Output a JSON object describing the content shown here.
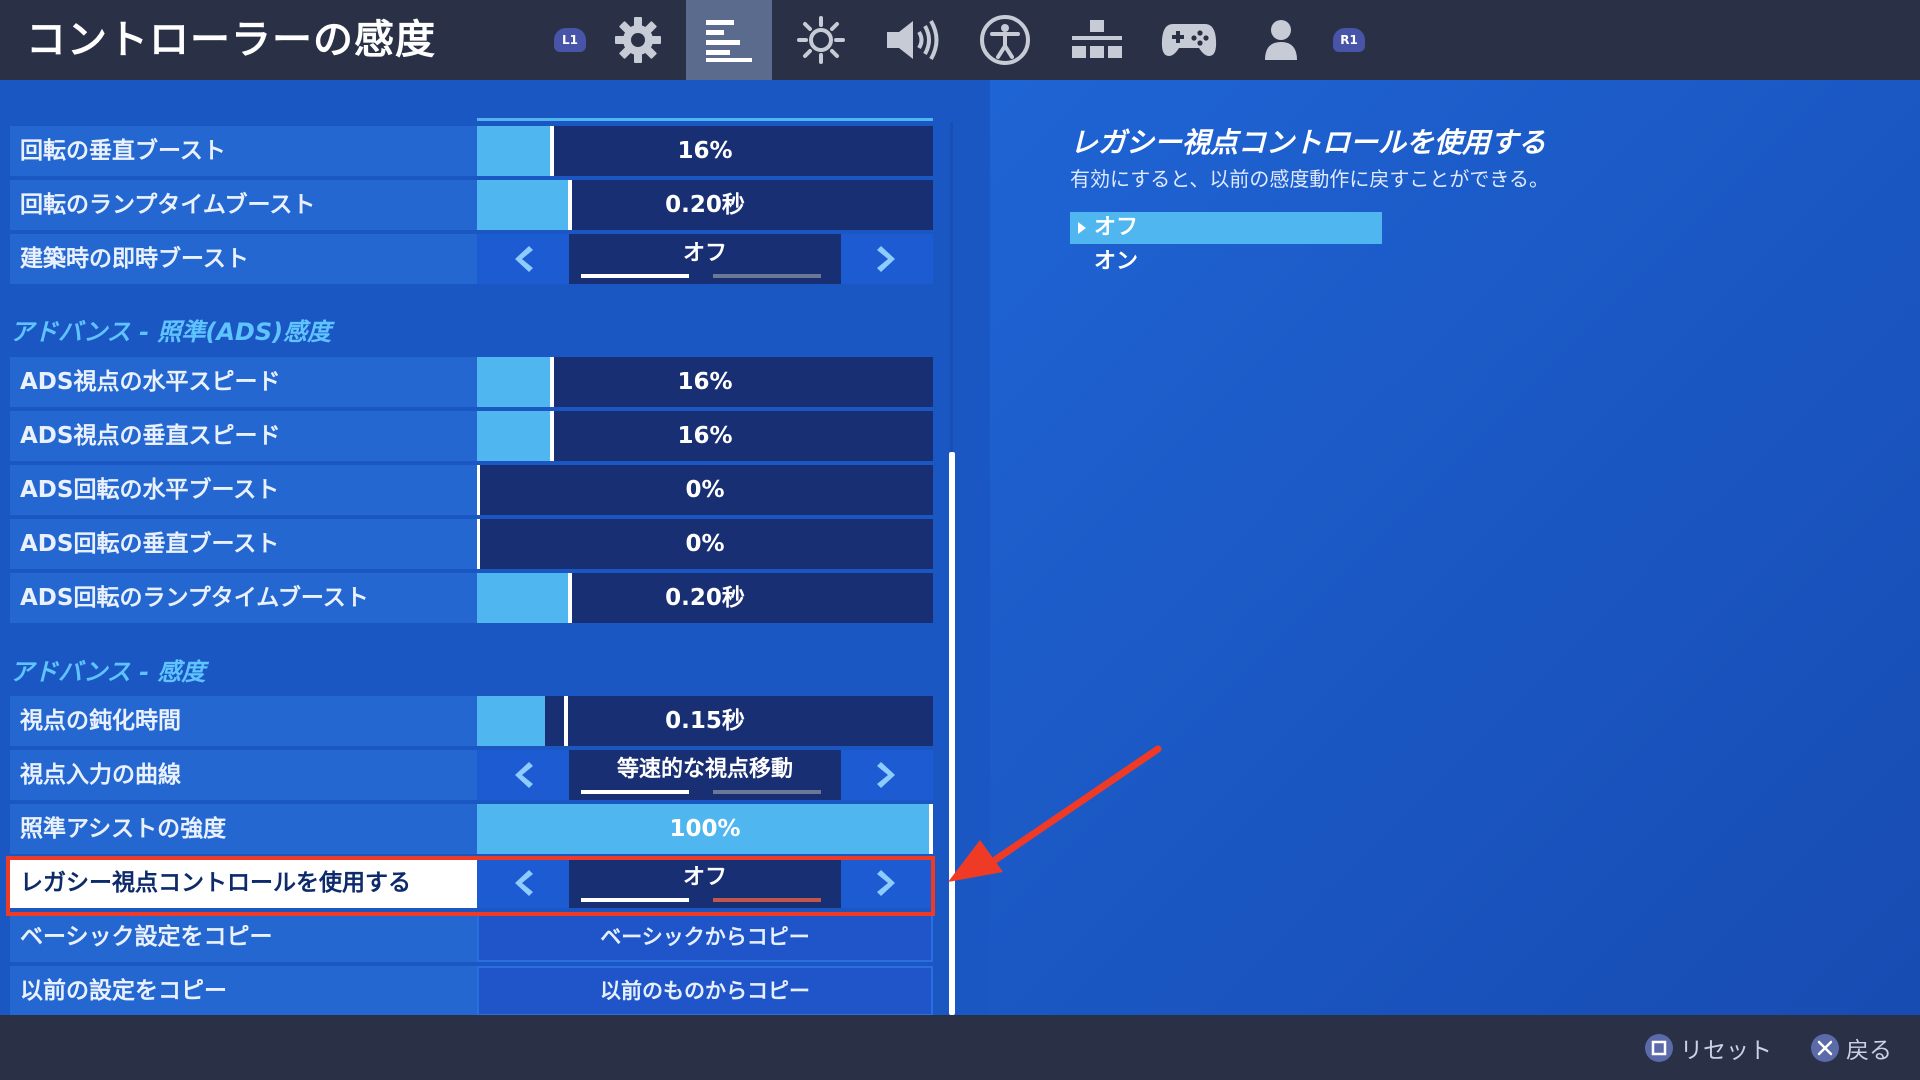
{
  "header": {
    "title": "コントローラーの感度",
    "tabs": [
      {
        "icon": "l1-bumper-icon",
        "label": "L1"
      },
      {
        "icon": "gear-icon"
      },
      {
        "icon": "list-settings-icon",
        "active": true
      },
      {
        "icon": "brightness-icon"
      },
      {
        "icon": "speaker-icon"
      },
      {
        "icon": "accessibility-icon"
      },
      {
        "icon": "build-blocks-icon"
      },
      {
        "icon": "gamepad-icon"
      },
      {
        "icon": "user-icon"
      },
      {
        "icon": "r1-bumper-icon",
        "label": "R1"
      }
    ]
  },
  "settings": {
    "rows_top": [
      {
        "label": "回転の垂直ブースト",
        "type": "slider",
        "value": "16%",
        "fill_fraction": 0.16
      },
      {
        "label": "回転のランプタイムブースト",
        "type": "slider",
        "value": "0.20秒",
        "fill_fraction": 0.2
      },
      {
        "label": "建築時の即時ブースト",
        "type": "selector",
        "value": "オフ",
        "option_index": 0,
        "option_count": 2
      }
    ],
    "section_ads": {
      "title": "アドバンス - 照準(ADS)感度",
      "rows": [
        {
          "label": "ADS視点の水平スピード",
          "type": "slider",
          "value": "16%",
          "fill_fraction": 0.16
        },
        {
          "label": "ADS視点の垂直スピード",
          "type": "slider",
          "value": "16%",
          "fill_fraction": 0.16
        },
        {
          "label": "ADS回転の水平ブースト",
          "type": "slider",
          "value": "0%",
          "fill_fraction": 0.0
        },
        {
          "label": "ADS回転の垂直ブースト",
          "type": "slider",
          "value": "0%",
          "fill_fraction": 0.0
        },
        {
          "label": "ADS回転のランプタイムブースト",
          "type": "slider",
          "value": "0.20秒",
          "fill_fraction": 0.2
        }
      ]
    },
    "section_sens": {
      "title": "アドバンス - 感度",
      "rows": [
        {
          "label": "視点の鈍化時間",
          "type": "slider",
          "value": "0.15秒",
          "fill_fraction": 0.15
        },
        {
          "label": "視点入力の曲線",
          "type": "selector",
          "value": "等速的な視点移動",
          "option_index": 0,
          "option_count": 2
        },
        {
          "label": "照準アシストの強度",
          "type": "slider",
          "value": "100%",
          "fill_fraction": 1.0
        },
        {
          "label": "レガシー視点コントロールを使用する",
          "type": "selector",
          "value": "オフ",
          "option_index": 0,
          "option_count": 2,
          "highlighted": true
        },
        {
          "label": "ベーシック設定をコピー",
          "type": "button",
          "value": "ベーシックからコピー"
        },
        {
          "label": "以前の設定をコピー",
          "type": "button",
          "value": "以前のものからコピー"
        }
      ]
    }
  },
  "detail": {
    "title": "レガシー視点コントロールを使用する",
    "description": "有効にすると、以前の感度動作に戻すことができる。",
    "options": [
      {
        "label": "オフ",
        "selected": true
      },
      {
        "label": "オン",
        "selected": false
      }
    ]
  },
  "footer": {
    "reset_label": "リセット",
    "back_label": "戻る"
  },
  "colors": {
    "accent_fill": "#4fb6f0",
    "highlight_border": "#ef3b25",
    "annotation_arrow": "#ef3b25"
  }
}
